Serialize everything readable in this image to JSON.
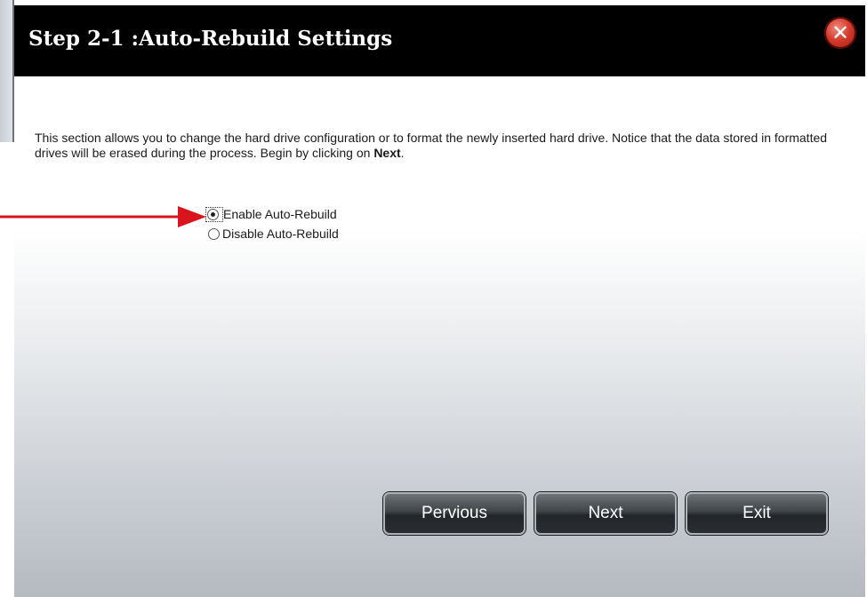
{
  "dialog": {
    "title": "Step 2-1 :Auto-Rebuild Settings",
    "close_icon": "close-icon",
    "description_text": "This section allows you to change the hard drive configuration or to format the newly inserted hard drive. Notice that the data stored in formatted drives will be erased during the process. Begin by clicking on ",
    "description_bold": "Next",
    "description_end": ".",
    "options": [
      {
        "label": "Enable Auto-Rebuild",
        "checked": true
      },
      {
        "label": "Disable Auto-Rebuild",
        "checked": false
      }
    ],
    "buttons": {
      "previous": "Pervious",
      "next": "Next",
      "exit": "Exit"
    }
  },
  "colors": {
    "titlebar": "#000000",
    "annotation_arrow": "#d9141c",
    "close_button": "#d33a2a"
  }
}
